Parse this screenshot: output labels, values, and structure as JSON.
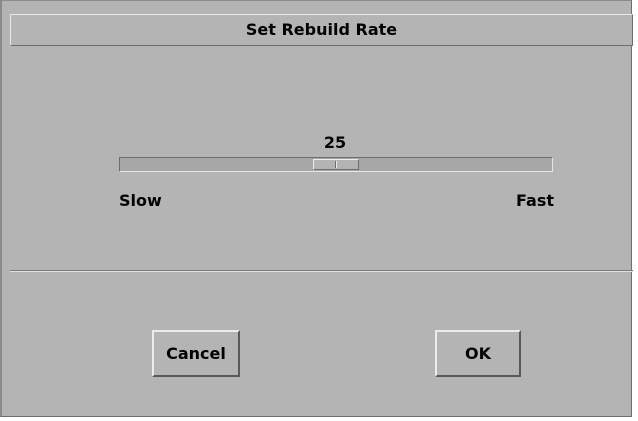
{
  "dialog": {
    "title": "Set Rebuild Rate"
  },
  "slider": {
    "value": 25,
    "value_label": "25",
    "level_fraction": 0.5,
    "min_label": "Slow",
    "max_label": "Fast"
  },
  "buttons": {
    "cancel_label": "Cancel",
    "ok_label": "OK"
  },
  "colors": {
    "dialog_bg": "#b4b4b4",
    "track_bg": "#a7a7a7",
    "bevel_light": "#ececec",
    "bevel_dark": "#6e6e6e"
  }
}
